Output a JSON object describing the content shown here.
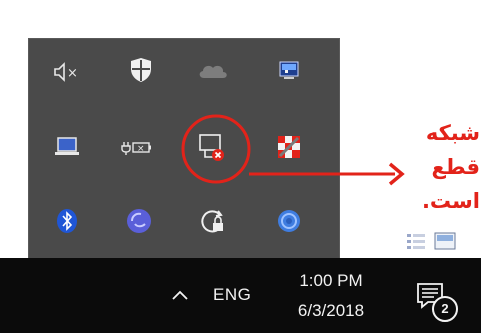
{
  "tray_flyout": {
    "icons": [
      {
        "name": "speaker-muted-icon",
        "label": "×"
      },
      {
        "name": "windows-defender-shield-icon"
      },
      {
        "name": "onedrive-cloud-icon"
      },
      {
        "name": "monitor-app-icon"
      },
      {
        "name": "laptop-display-icon"
      },
      {
        "name": "battery-plugged-icon",
        "label": "×"
      },
      {
        "name": "network-disconnected-icon",
        "status": "disconnected",
        "highlighted": true
      },
      {
        "name": "checkered-app-icon"
      },
      {
        "name": "bluetooth-icon"
      },
      {
        "name": "blue-disc-app-icon"
      },
      {
        "name": "lock-refresh-icon"
      },
      {
        "name": "blue-circle-app-icon"
      }
    ]
  },
  "annotation": {
    "lines": [
      "شبکه",
      "قطع",
      "است."
    ],
    "color": "#e2231a"
  },
  "taskbar": {
    "language": "ENG",
    "time": "1:00 PM",
    "date": "6/3/2018",
    "notification_count": "2"
  },
  "colors": {
    "flyout_bg": "#4a4a4a",
    "taskbar_bg": "#0b0b0b",
    "accent_red": "#e2231a"
  }
}
